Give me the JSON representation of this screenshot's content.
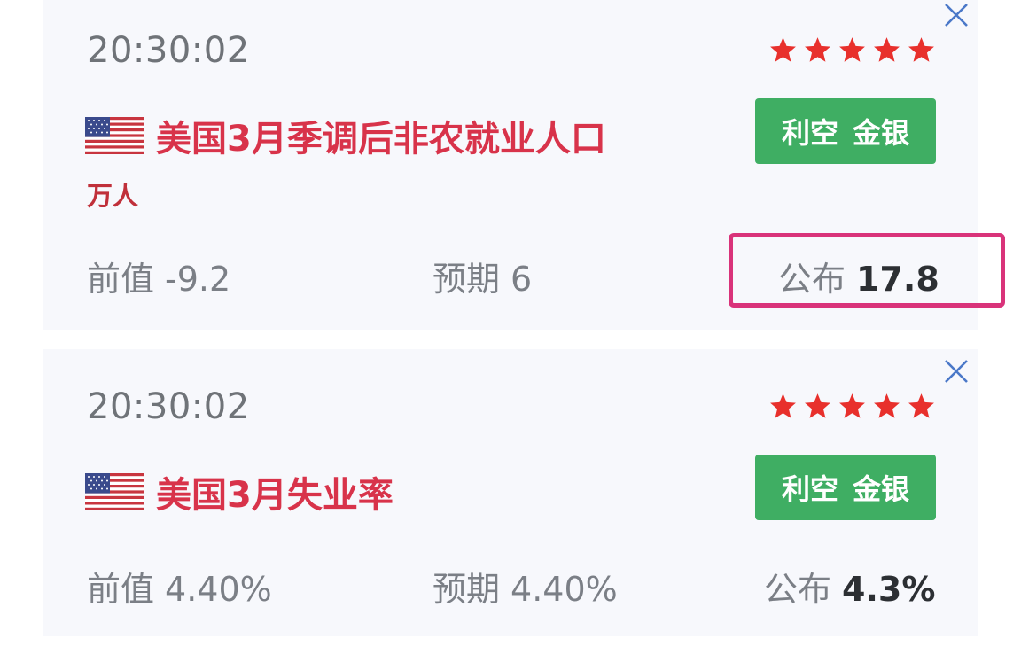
{
  "colors": {
    "card_bg": "#f7f8fc",
    "title_red": "#d8334a",
    "star_red": "#e8302c",
    "badge_green": "#3fae63",
    "close_blue": "#4a78c8",
    "highlight_pink": "#d9337a"
  },
  "events": [
    {
      "time": "20:30:02",
      "rating_stars": 5,
      "title": "美国3月季调后非农就业人口",
      "unit": "万人",
      "badge": {
        "effect": "利空",
        "asset": "金银"
      },
      "previous": {
        "label": "前值",
        "value": "-9.2"
      },
      "forecast": {
        "label": "预期",
        "value": "6"
      },
      "actual": {
        "label": "公布",
        "value": "17.8"
      },
      "highlighted": true,
      "flag_icon": "us-flag-icon",
      "close_icon": "close-icon"
    },
    {
      "time": "20:30:02",
      "rating_stars": 5,
      "title": "美国3月失业率",
      "badge": {
        "effect": "利空",
        "asset": "金银"
      },
      "previous": {
        "label": "前值",
        "value": "4.40%"
      },
      "forecast": {
        "label": "预期",
        "value": "4.40%"
      },
      "actual": {
        "label": "公布",
        "value": "4.3%"
      },
      "highlighted": false,
      "flag_icon": "us-flag-icon",
      "close_icon": "close-icon"
    }
  ]
}
